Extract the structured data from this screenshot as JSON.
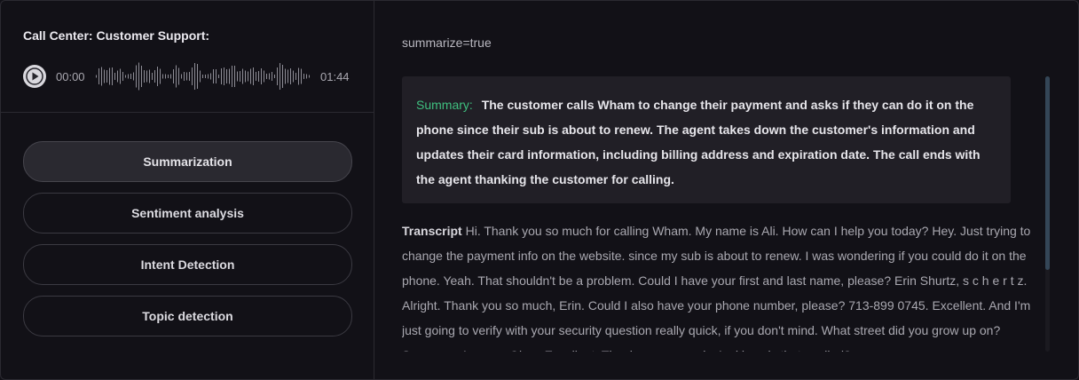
{
  "left_panel": {
    "call_title": "Call Center: Customer Support:",
    "player": {
      "time_current": "00:00",
      "time_total": "01:44",
      "play_icon": "play-icon"
    },
    "tasks": [
      {
        "label": "Summarization",
        "active": true
      },
      {
        "label": "Sentiment analysis",
        "active": false
      },
      {
        "label": "Intent Detection",
        "active": false
      },
      {
        "label": "Topic detection",
        "active": false
      }
    ]
  },
  "right_panel": {
    "param": "summarize=true",
    "summary_label": "Summary:",
    "summary_text": "The customer calls Wham to change their payment and asks if they can do it on the phone since their sub is about to renew. The agent takes down the customer's information and updates their card information, including billing address and expiration date. The call ends with the agent thanking the customer for calling.",
    "transcript_label": "Transcript",
    "transcript_text": "Hi. Thank you so much for calling Wham. My name is Ali. How can I help you today? Hey. Just trying to change the payment info on the website. since my sub is about to renew. I was wondering if you could do it on the phone. Yeah. That shouldn't be a problem. Could I have your first and last name, please? Erin Shurtz, s c h e r t z. Alright. Thank you so much, Erin. Could I also have your phone number, please? 713-899 0745. Excellent. And I'm just going to verify with your security question really quick, if you don't mind. What street did you grow up on? Sycamore Avenue. Okay. Excellent. Thank you so much. And how is that spelled?"
  },
  "colors": {
    "background": "#121117",
    "summary_accent": "#3fbf7f",
    "active_button": "#2a2930",
    "scrollbar_thumb": "#344657"
  }
}
